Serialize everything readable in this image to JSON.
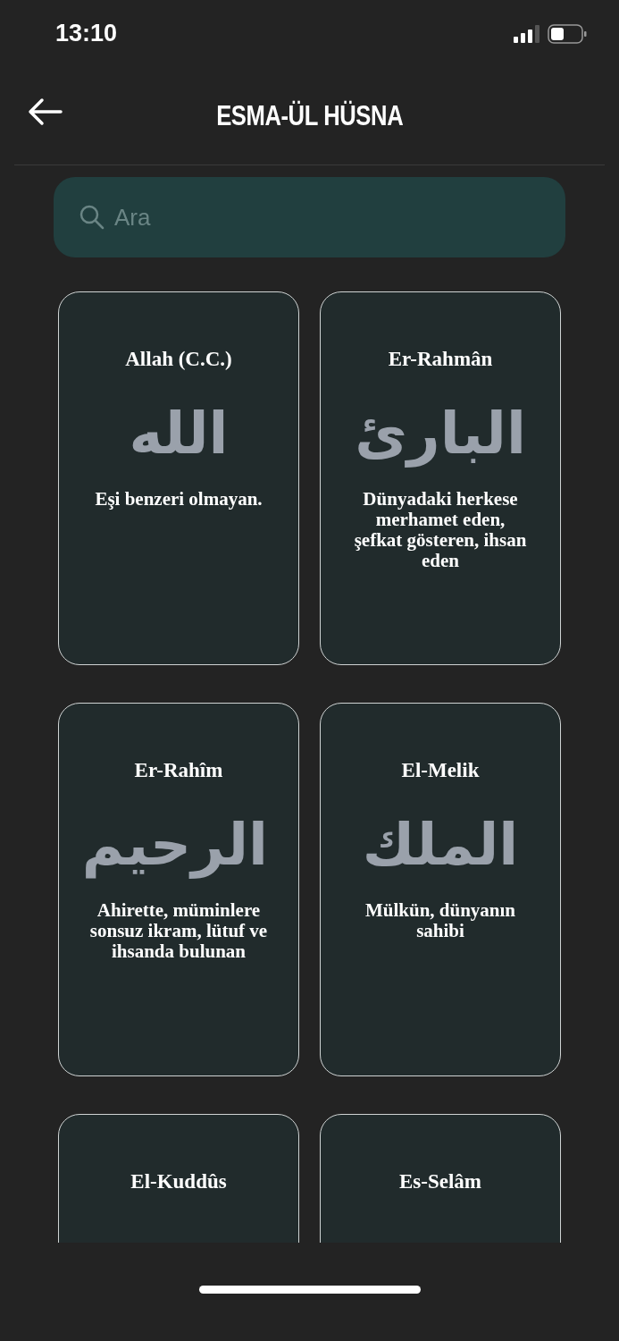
{
  "status_bar": {
    "time": "13:10"
  },
  "header": {
    "title": "ESMA-ÜL HÜSNA"
  },
  "search": {
    "placeholder": "Ara"
  },
  "cards": [
    {
      "name": "Allah (C.C.)",
      "calligraphy": "الله",
      "meaning": "Eşi benzeri olmayan."
    },
    {
      "name": "Er-Rahmân",
      "calligraphy": "البارئ",
      "meaning": "Dünyadaki herkese merhamet eden, şefkat gösteren, ihsan eden"
    },
    {
      "name": "Er-Rahîm",
      "calligraphy": "الرحيم",
      "meaning": "Ahirette, müminlere sonsuz ikram, lütuf ve ihsanda bulunan"
    },
    {
      "name": "El-Melik",
      "calligraphy": "الملك",
      "meaning": "Mülkün, dünyanın sahibi"
    },
    {
      "name": "El-Kuddûs"
    },
    {
      "name": "Es-Selâm"
    }
  ]
}
